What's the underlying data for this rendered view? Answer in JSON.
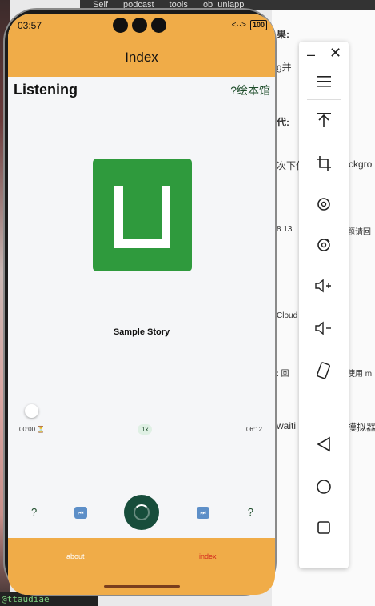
{
  "background": {
    "topbar_items": [
      "Self",
      "podcast",
      "tools",
      "ob_uniapp"
    ],
    "doc_lines": [
      "果:",
      "g并",
      "代:",
      "次下位",
      "ckgro",
      "8 13",
      "题请回",
      "Cloud",
      "i",
      ": 回",
      "使用 m",
      "waiti",
      "模拟器"
    ],
    "terminal_text": "@ttaudiae"
  },
  "status": {
    "time": "03:57",
    "signal": "<··>",
    "battery": "100"
  },
  "nav": {
    "title": "Index"
  },
  "page": {
    "heading": "Listening",
    "link": "?绘本馆",
    "story_title": "Sample Story",
    "cover_color": "#2f9a3d"
  },
  "player": {
    "current_time": "00:00",
    "hourglass": "⏳",
    "rate": "1x",
    "duration": "06:12",
    "progress_fraction": 0,
    "left_extra": "?",
    "right_extra": "?",
    "prev_icon": "⏮",
    "next_icon": "⏭"
  },
  "tabs": [
    {
      "label": "about",
      "active": false
    },
    {
      "label": "index",
      "active": true
    }
  ],
  "colors": {
    "accent": "#f0ac48",
    "active_tab": "#d42b1e",
    "play_button": "#174d3b"
  }
}
